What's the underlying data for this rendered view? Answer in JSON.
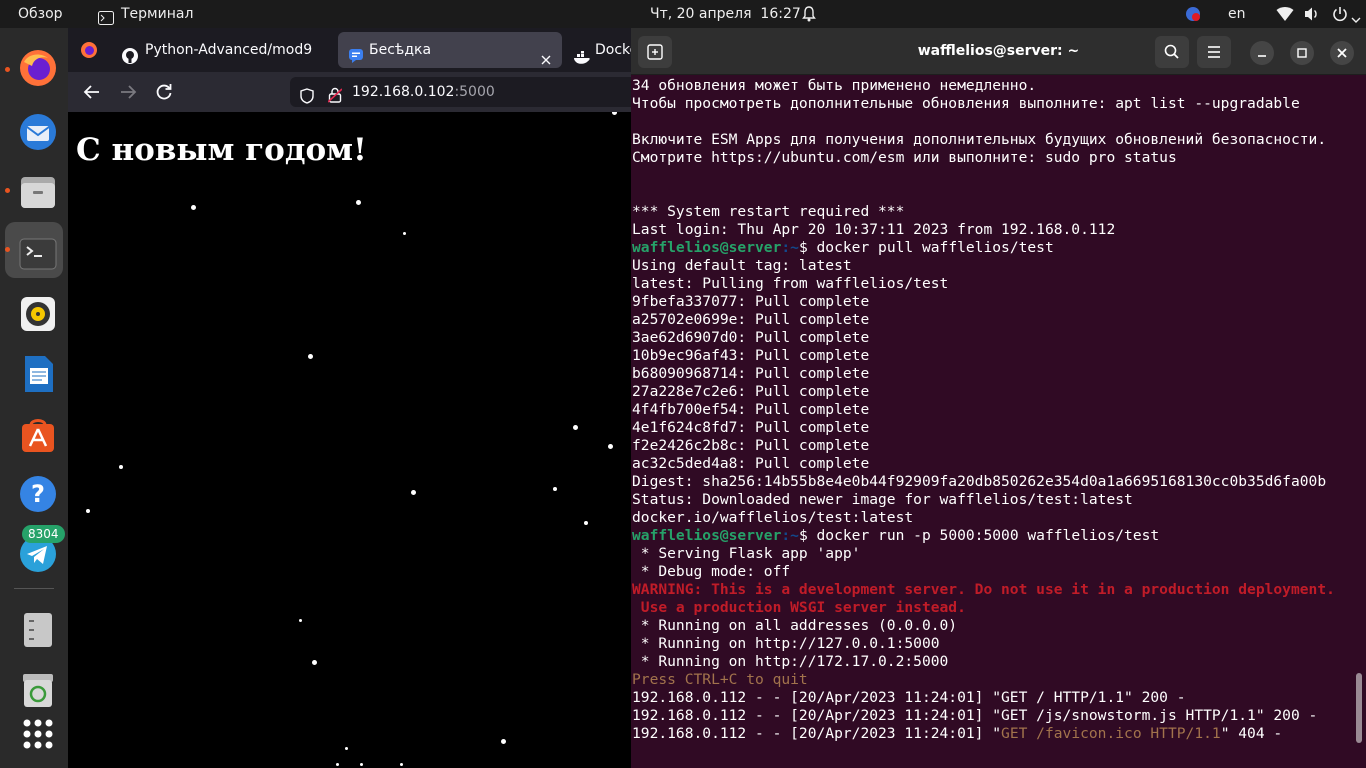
{
  "topbar": {
    "activities": "Обзор",
    "app_name": "Терминал",
    "clock": "Чт, 20 апреля  16:27",
    "language": "en"
  },
  "dock": {
    "telegram_badge": "8304"
  },
  "browser": {
    "tabs": [
      {
        "label": "Python-Advanced/mod9"
      },
      {
        "label": "Бесѣдка"
      },
      {
        "label": "Docke"
      }
    ],
    "url_host": "192.168.0.102",
    "url_port": ":5000",
    "page_heading": "С новым годом!"
  },
  "terminal": {
    "title": "wafflelios@server: ~",
    "lines": [
      {
        "text": "34 обновления может быть применено немедленно."
      },
      {
        "text": "Чтобы просмотреть дополнительные обновления выполните: apt list --upgradable"
      },
      {
        "text": ""
      },
      {
        "text": "Включите ESM Apps для получения дополнительных будущих обновлений безопасности."
      },
      {
        "text": "Смотрите https://ubuntu.com/esm или выполните: sudo pro status"
      },
      {
        "text": ""
      },
      {
        "text": ""
      },
      {
        "text": "*** System restart required ***"
      },
      {
        "text": "Last login: Thu Apr 20 10:37:11 2023 from 192.168.0.112"
      },
      {
        "prompt_user": "wafflelios@server",
        "prompt_path": ":~",
        "command": "$ docker pull wafflelios/test"
      },
      {
        "text": "Using default tag: latest"
      },
      {
        "text": "latest: Pulling from wafflelios/test"
      },
      {
        "text": "9fbefa337077: Pull complete"
      },
      {
        "text": "a25702e0699e: Pull complete"
      },
      {
        "text": "3ae62d6907d0: Pull complete"
      },
      {
        "text": "10b9ec96af43: Pull complete"
      },
      {
        "text": "b68090968714: Pull complete"
      },
      {
        "text": "27a228e7c2e6: Pull complete"
      },
      {
        "text": "4f4fb700ef54: Pull complete"
      },
      {
        "text": "4e1f624c8fd7: Pull complete"
      },
      {
        "text": "f2e2426c2b8c: Pull complete"
      },
      {
        "text": "ac32c5ded4a8: Pull complete"
      },
      {
        "text": "Digest: sha256:14b55b8e4e0b44f92909fa20db850262e354d0a1a6695168130cc0b35d6fa00b"
      },
      {
        "text": "Status: Downloaded newer image for wafflelios/test:latest"
      },
      {
        "text": "docker.io/wafflelios/test:latest"
      },
      {
        "prompt_user": "wafflelios@server",
        "prompt_path": ":~",
        "command": "$ docker run -p 5000:5000 wafflelios/test"
      },
      {
        "text": " * Serving Flask app 'app'"
      },
      {
        "text": " * Debug mode: off"
      },
      {
        "text": "WARNING: This is a development server. Do not use it in a production deployment.",
        "style": "warn"
      },
      {
        "text": " Use a production WSGI server instead.",
        "style": "warn"
      },
      {
        "text": " * Running on all addresses (0.0.0.0)"
      },
      {
        "text": " * Running on http://127.0.0.1:5000"
      },
      {
        "text": " * Running on http://172.17.0.2:5000"
      },
      {
        "text": "Press CTRL+C to quit",
        "style": "dim"
      },
      {
        "text": "192.168.0.112 - - [20/Apr/2023 11:24:01] \"GET / HTTP/1.1\" 200 -"
      },
      {
        "text": "192.168.0.112 - - [20/Apr/2023 11:24:01] \"GET /js/snowstorm.js HTTP/1.1\" 200 -"
      },
      {
        "pre": "192.168.0.112 - - [20/Apr/2023 11:24:01] \"",
        "dim": "GET /favicon.ico HTTP/1.1",
        "post": "\" 404 -"
      }
    ]
  }
}
